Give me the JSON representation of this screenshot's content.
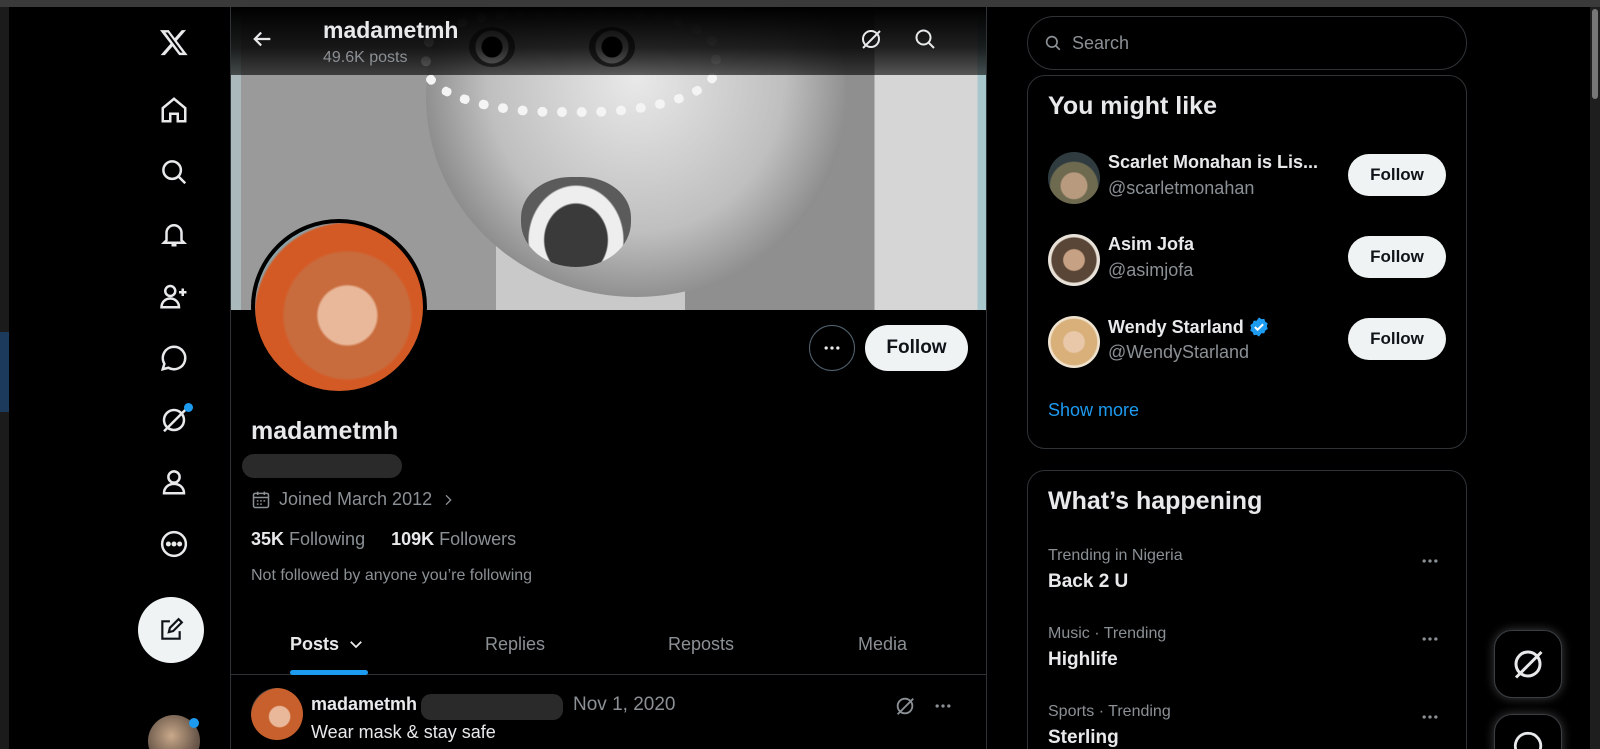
{
  "nav": {
    "items": [
      {
        "name": "x-logo",
        "icon": "x-logo-icon"
      },
      {
        "name": "home",
        "icon": "home-icon"
      },
      {
        "name": "explore",
        "icon": "search-icon"
      },
      {
        "name": "notifications",
        "icon": "bell-icon"
      },
      {
        "name": "communities",
        "icon": "person-add-icon"
      },
      {
        "name": "messages",
        "icon": "chat-icon"
      },
      {
        "name": "grok",
        "icon": "grok-icon"
      },
      {
        "name": "profile",
        "icon": "person-icon"
      },
      {
        "name": "more",
        "icon": "more-circle-icon"
      }
    ],
    "compose_icon": "compose-icon"
  },
  "header": {
    "name": "madametmh",
    "posts_count": "49.6K posts"
  },
  "profile": {
    "display_name": "madametmh",
    "joined": "Joined March 2012",
    "following_count": "35K",
    "following_label": "Following",
    "followers_count": "109K",
    "followers_label": "Followers",
    "not_followed": "Not followed by anyone you’re following",
    "follow_label": "Follow"
  },
  "tabs": [
    {
      "label": "Posts"
    },
    {
      "label": "Replies"
    },
    {
      "label": "Reposts"
    },
    {
      "label": "Media"
    }
  ],
  "post": {
    "author": "madametmh",
    "date": "Nov 1, 2020",
    "text": "Wear mask & stay safe"
  },
  "search": {
    "placeholder": "Search"
  },
  "you_might_like": {
    "title": "You might like",
    "suggestions": [
      {
        "name": "Scarlet Monahan is Lis...",
        "handle": "@scarletmonahan",
        "follow": "Follow",
        "verified": false
      },
      {
        "name": "Asim Jofa",
        "handle": "@asimjofa",
        "follow": "Follow",
        "verified": false
      },
      {
        "name": "Wendy Starland",
        "handle": "@WendyStarland",
        "follow": "Follow",
        "verified": true
      }
    ],
    "show_more": "Show more"
  },
  "whats_happening": {
    "title": "What’s happening",
    "trends": [
      {
        "meta": "Trending in Nigeria",
        "name": "Back 2 U"
      },
      {
        "meta": "Music · Trending",
        "name": "Highlife"
      },
      {
        "meta": "Sports · Trending",
        "name": "Sterling"
      }
    ]
  },
  "colors": {
    "accent": "#1d9bf0",
    "background": "#000000",
    "text": "#e7e9ea",
    "muted": "#8b9095",
    "button_bg": "#eff3f4"
  }
}
